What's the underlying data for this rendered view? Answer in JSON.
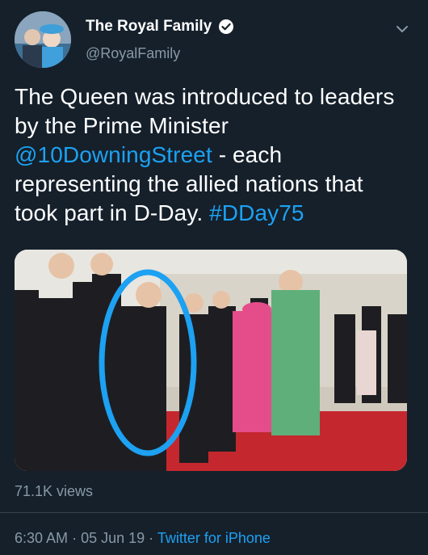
{
  "tweet": {
    "display_name": "The Royal Family",
    "handle": "@RoyalFamily",
    "text_part1": "The Queen was introduced to leaders by the Prime Minister ",
    "mention": "@10DowningStreet",
    "text_part2": " - each representing the allied nations that took part in D-Day. ",
    "hashtag": "#DDay75",
    "views": "71.1K views",
    "time": "6:30 AM",
    "separator": "·",
    "date": "05 Jun 19",
    "source": "Twitter for iPhone"
  },
  "icons": {
    "verified": "verified-badge-icon",
    "menu": "chevron-down-icon"
  },
  "colors": {
    "background": "#15202b",
    "text": "#ffffff",
    "secondary": "#8899a6",
    "link": "#1da1f2",
    "annotation": "#1da1f2"
  }
}
